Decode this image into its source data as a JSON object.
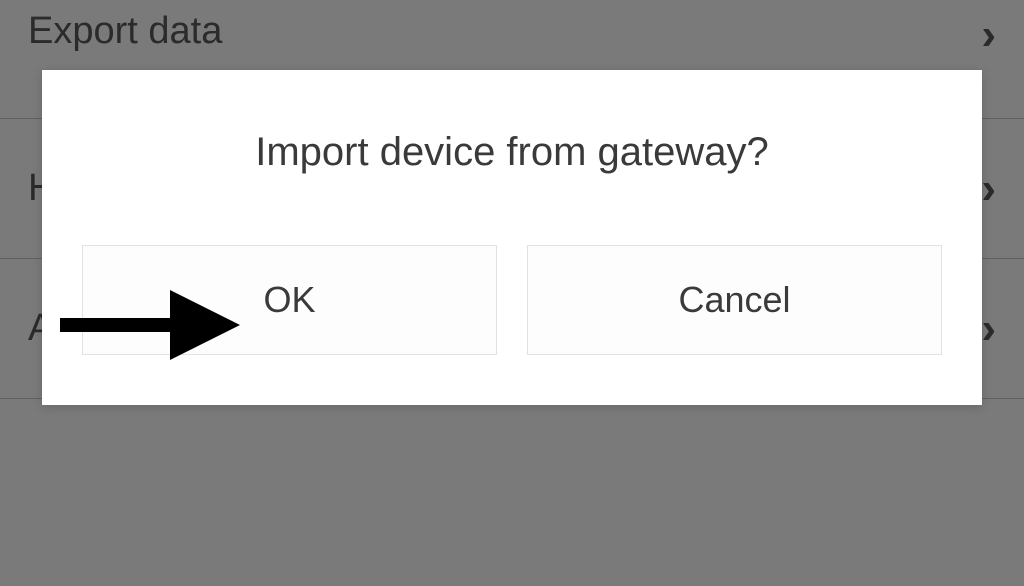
{
  "background": {
    "items": [
      {
        "label": "Export data"
      },
      {
        "label": "H"
      },
      {
        "label": "A"
      }
    ]
  },
  "dialog": {
    "title": "Import device from gateway?",
    "ok_label": "OK",
    "cancel_label": "Cancel"
  }
}
